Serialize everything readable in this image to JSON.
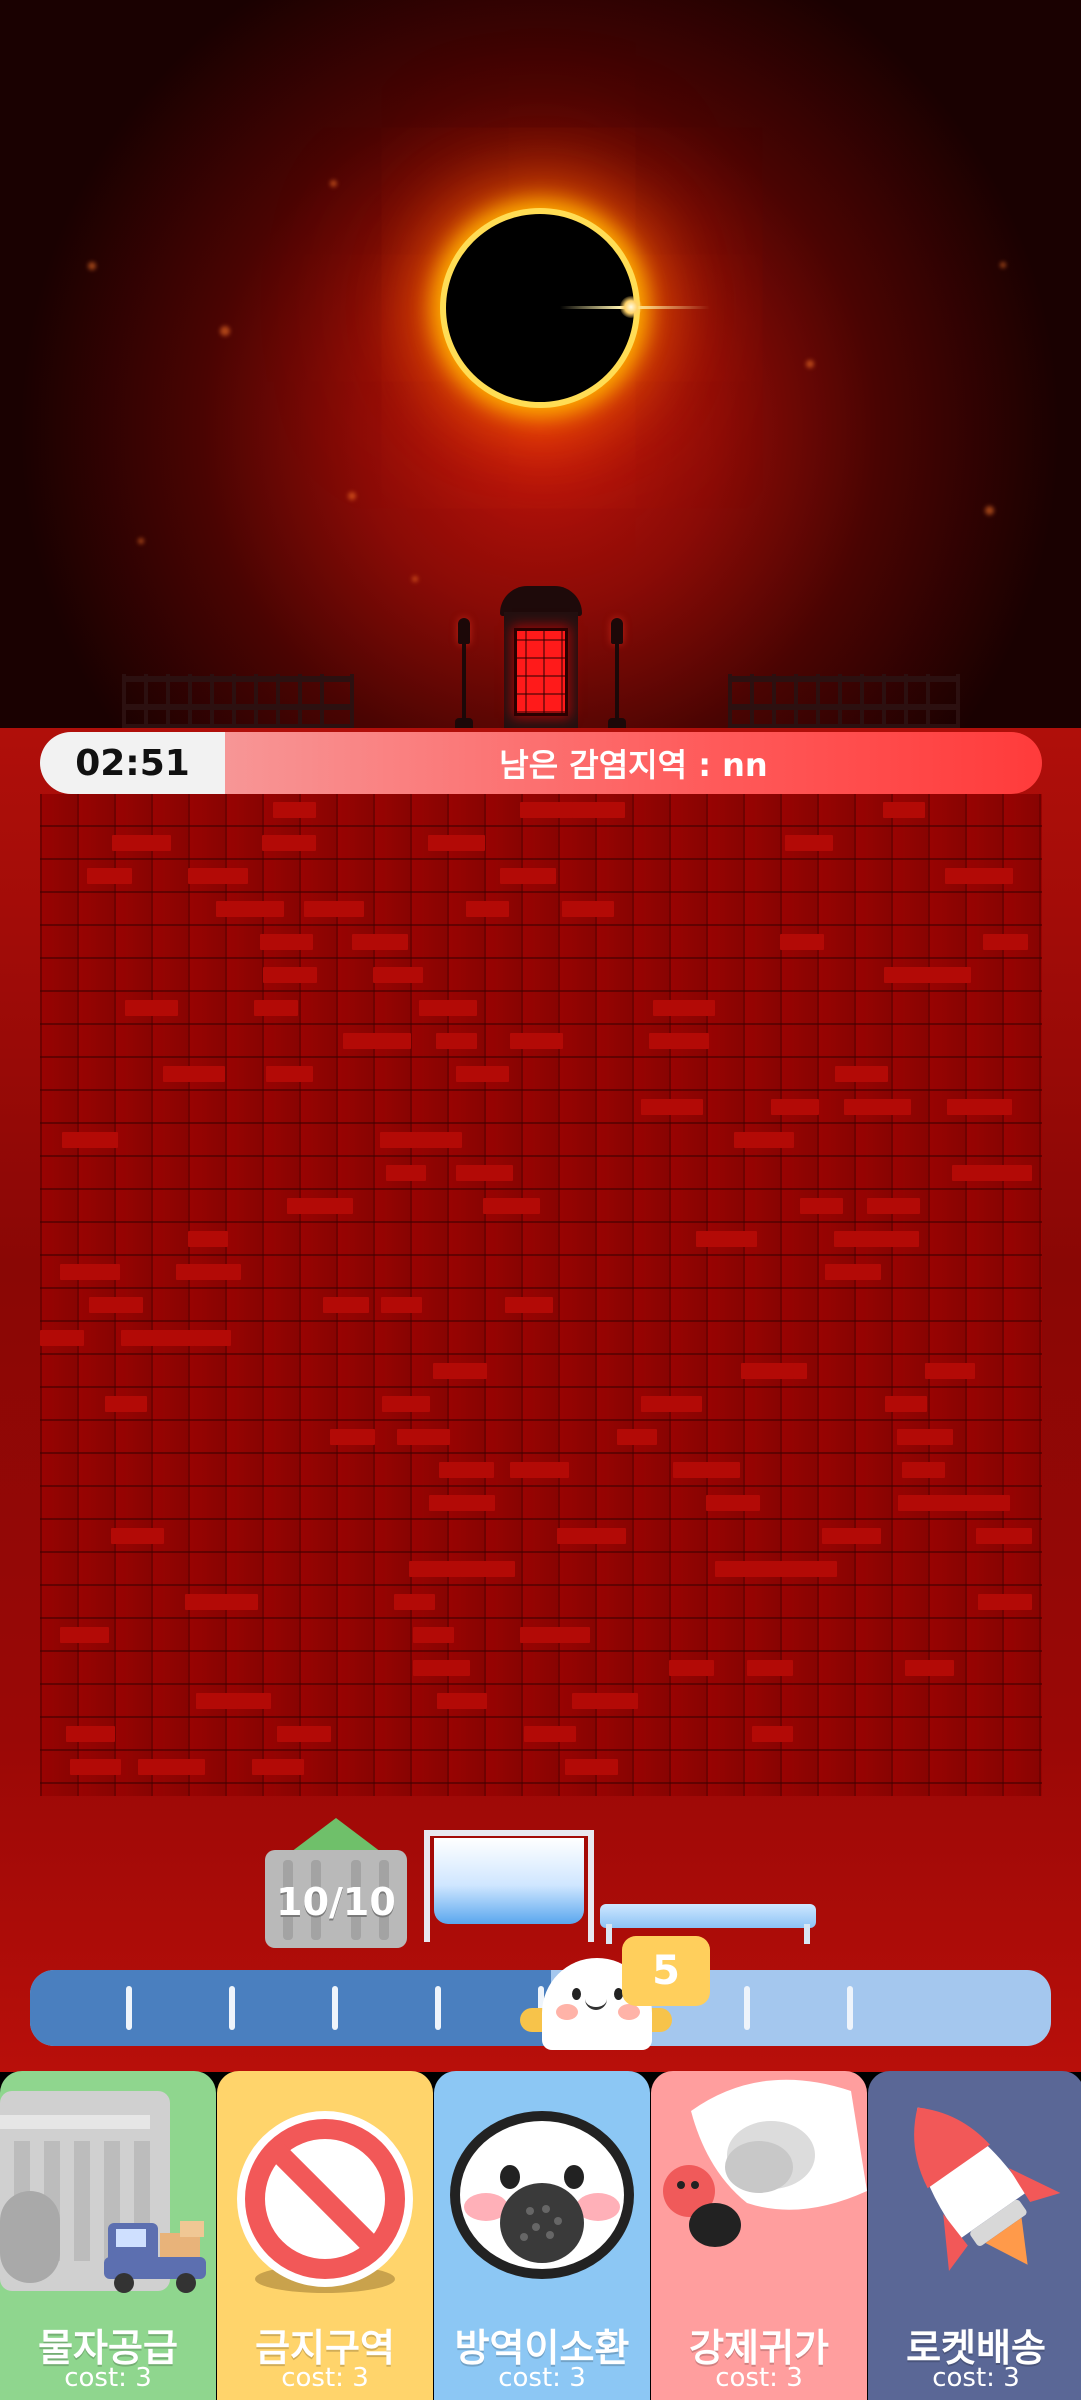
{
  "hud": {
    "timer": "02:51",
    "remaining_text": "남은 감염지역 : nn"
  },
  "resources": {
    "building_count": "10/10"
  },
  "progress": {
    "level_fraction": 0.51,
    "ticks": 8,
    "counter": "5"
  },
  "cards": [
    {
      "title": "물자공급",
      "cost": "cost: 3",
      "color": "#8fd68e",
      "icon": "supply-truck-icon"
    },
    {
      "title": "금지구역",
      "cost": "cost: 3",
      "color": "#ffd46b",
      "icon": "prohibited-icon"
    },
    {
      "title": "방역이소환",
      "cost": "cost: 3",
      "color": "#8cc7f4",
      "icon": "mask-icon"
    },
    {
      "title": "강제귀가",
      "cost": "cost: 3",
      "color": "#ff9e9e",
      "icon": "grab-hand-icon"
    },
    {
      "title": "로켓배송",
      "cost": "cost: 3",
      "color": "#5a6796",
      "icon": "rocket-icon"
    }
  ],
  "colors": {
    "sky": "#8a0b06",
    "wall": "#8c0503",
    "progress_fill": "#4a7fbf",
    "progress_track": "#a4c7ee"
  }
}
